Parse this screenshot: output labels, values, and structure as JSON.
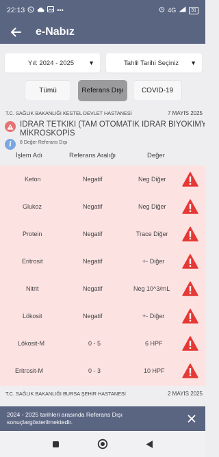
{
  "status_bar": {
    "time": "22:13",
    "icons_left": [
      "whatsapp-icon",
      "cloud-icon",
      "gallery-icon",
      "more-icon"
    ],
    "battery": "31",
    "signal": "4G"
  },
  "app": {
    "title": "e-Nabız"
  },
  "filters": {
    "year": "Yıl: 2024 - 2025",
    "date": "Tahlil Tarihi Seçiniz"
  },
  "tabs": [
    {
      "label": "Tümü"
    },
    {
      "label": "Referans Dışı"
    },
    {
      "label": "COVID-19"
    }
  ],
  "result_group": {
    "hospital": "T.C. SAĞLIK BAKANLIĞI KESTEL DEVLET HASTANESİ",
    "date": "7 MAYIS 2025",
    "title_line1": "İDRAR TETKİKİ (TAM OTOMATİK İDRAR BİYOKİMYASI VE",
    "title_line2": "MİKROSKOPİS",
    "info": "8 Değer Referans Dışı",
    "columns": {
      "name": "İşlem Adı",
      "range": "Referans Aralığı",
      "value": "Değer"
    },
    "rows": [
      {
        "name": "Keton",
        "range": "Negatif",
        "value": "Neg Diğer"
      },
      {
        "name": "Glukoz",
        "range": "Negatif",
        "value": "Neg Diğer"
      },
      {
        "name": "Protein",
        "range": "Negatif",
        "value": "Trace Diğer"
      },
      {
        "name": "Eritrosit",
        "range": "Negatif",
        "value": "+- Diğer"
      },
      {
        "name": "Nitrit",
        "range": "Negatif",
        "value": "Neg 10^3/mL"
      },
      {
        "name": "Lökosit",
        "range": "Negatif",
        "value": "+- Diğer"
      },
      {
        "name": "Lökosit-M",
        "range": "0 - 5",
        "value": "6 HPF"
      },
      {
        "name": "Eritrosit-M",
        "range": "0 - 3",
        "value": "10 HPF"
      }
    ]
  },
  "next_group": {
    "hospital": "T.C. SAĞLIK BAKANLIĞI BURSA ŞEHİR HASTANESİ",
    "date": "2 MAYIS 2025"
  },
  "snackbar": {
    "message": "2024 - 2025 tarihleri arasında Referans Dışı sonuçlargösterilmektedir."
  },
  "colors": {
    "header": "#5a6582",
    "alert_row_bg": "#fde2e2",
    "warning_red": "#e53935",
    "info_blue": "#7aa7e0"
  }
}
